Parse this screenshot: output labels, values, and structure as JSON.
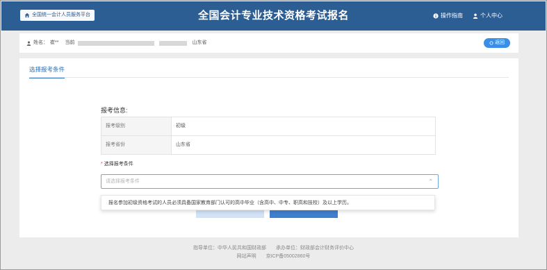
{
  "header": {
    "platform_button": "全国统一会计人员服务平台",
    "title": "全国会计专业技术资格考试报名",
    "guide": "操作指南",
    "personal_center": "个人中心"
  },
  "user_bar": {
    "name_label": "姓名：",
    "name_value": "崔**",
    "prefix": "当前",
    "province": "山东省",
    "back_button": "返回"
  },
  "tabs": {
    "active": "选择报考条件"
  },
  "exam_info": {
    "title": "报考信息:",
    "rows": [
      {
        "key": "报考级别",
        "value": "初级"
      },
      {
        "key": "报考省份",
        "value": "山东省"
      }
    ]
  },
  "condition": {
    "label": "选择报考条件",
    "placeholder": "请选择报考条件",
    "dropdown_option": "报名参加初级资格考试的人员必须具备国家教育部门认可的高中毕业（含高中、中专、职高和技校）及以上学历。"
  },
  "footer": {
    "guide_unit": "指导单位：中华人民共和国财政部",
    "host_unit": "承办单位：财政部会计财务评价中心",
    "statement": "网站声明",
    "icp": "京ICP备05002860号"
  },
  "colors": {
    "header_bg": "#2d5e93",
    "accent": "#2d6fb6",
    "button": "#3b8ee8"
  }
}
